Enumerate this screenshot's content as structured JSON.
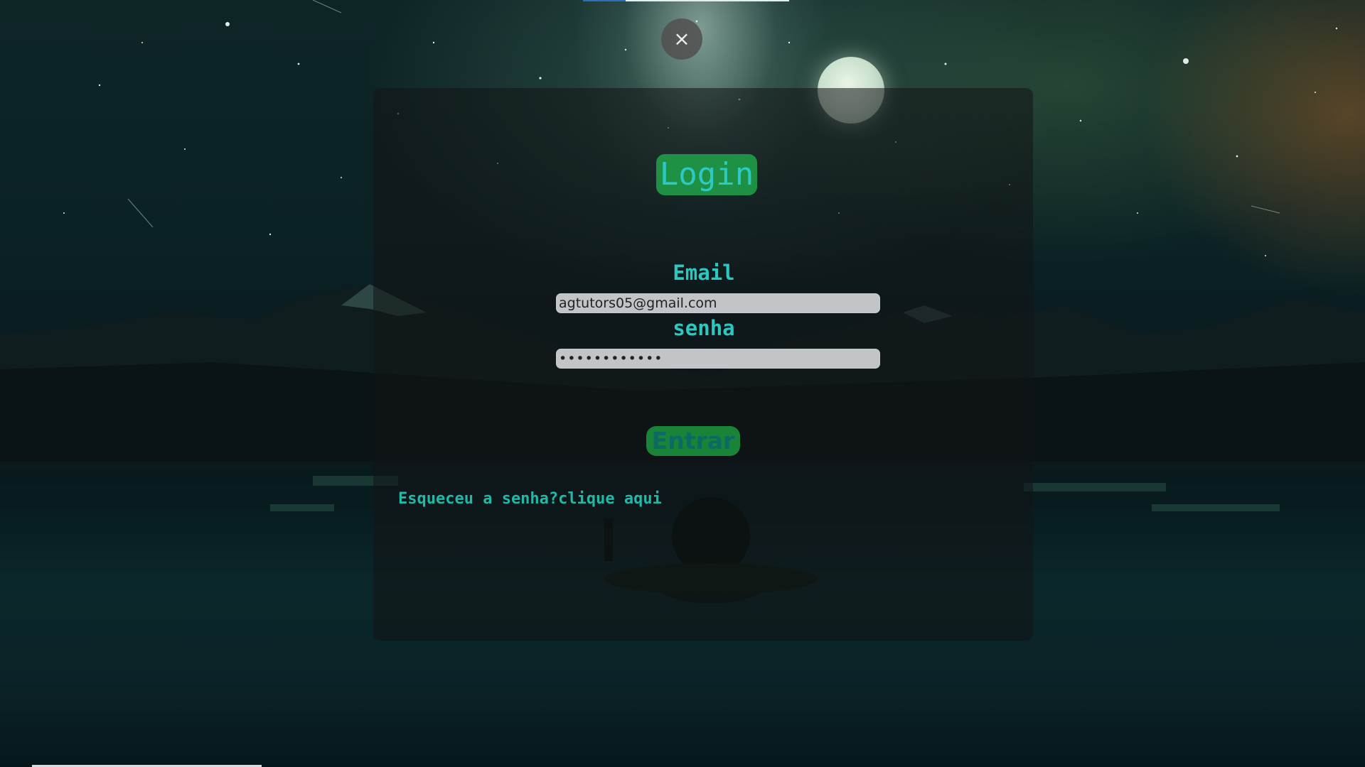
{
  "dialog": {
    "close_icon": "×"
  },
  "login": {
    "title": "Login",
    "email_label": "Email",
    "email_value": "agtutors05@gmail.com",
    "password_label": "senha",
    "password_value": "************",
    "submit_label": "Entrar",
    "forgot_text": "Esqueceu a senha?",
    "forgot_link": "clique aqui"
  },
  "colors": {
    "accent_green": "#1f9a48",
    "label_cyan": "#2bc8c0",
    "link_teal": "#1fb9a8"
  }
}
